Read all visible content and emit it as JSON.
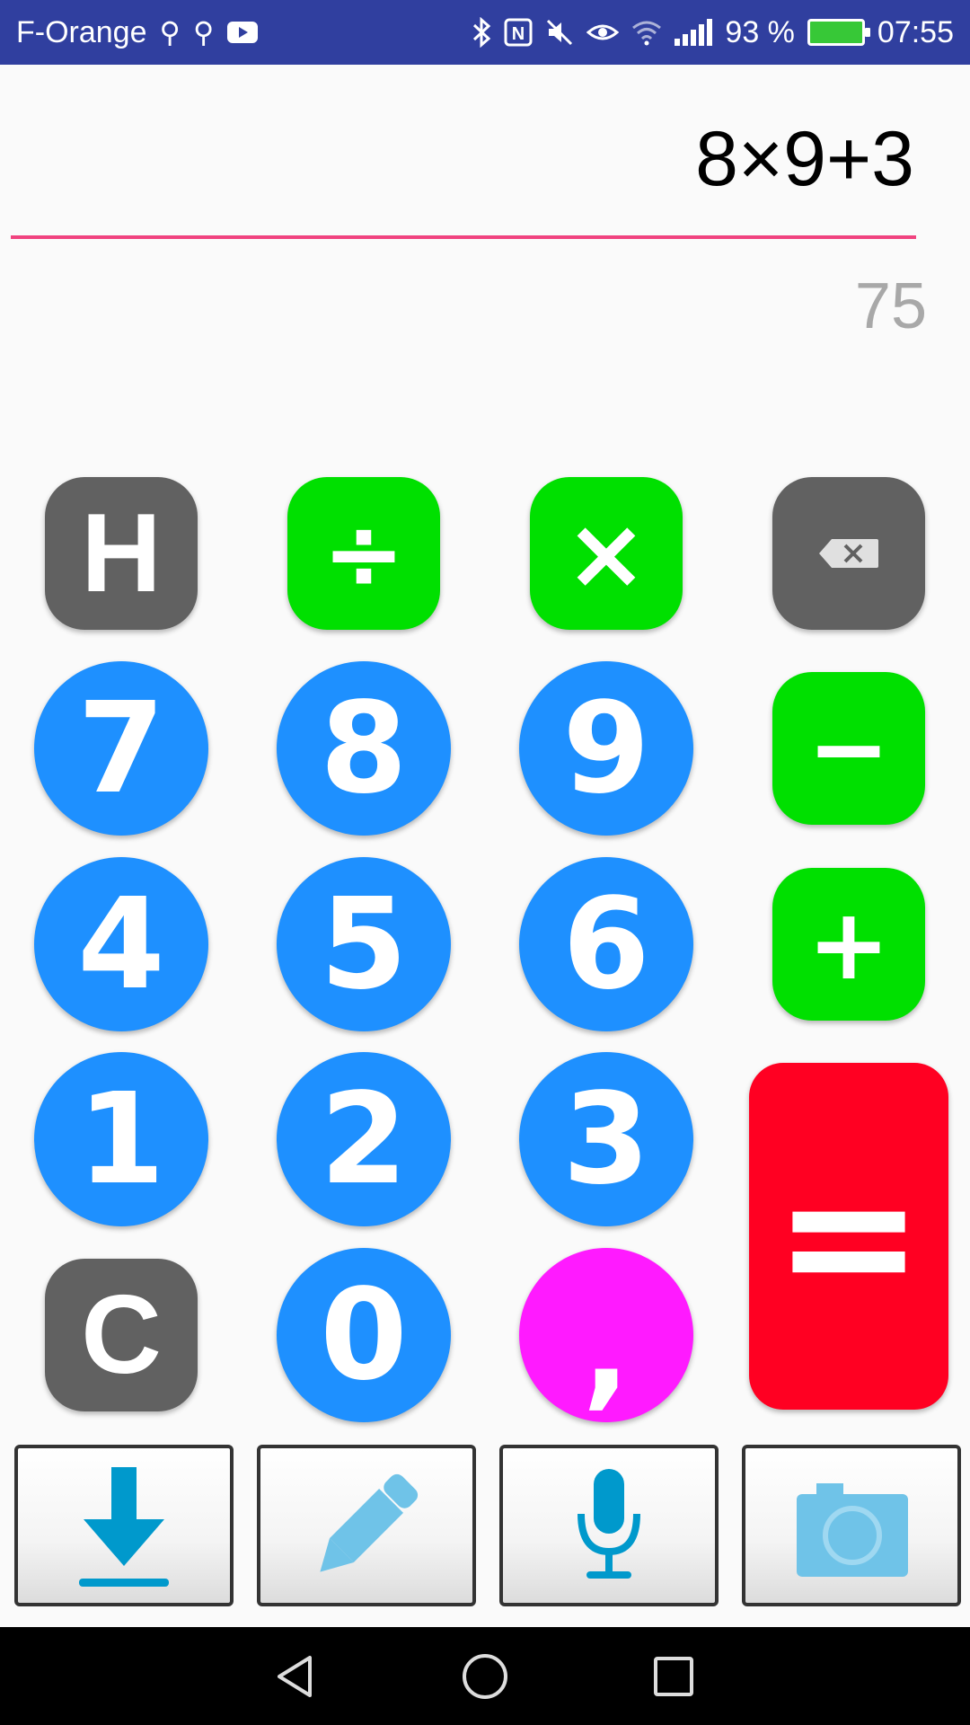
{
  "status_bar": {
    "carrier": "F-Orange",
    "battery_percent": "93 %",
    "time": "07:55",
    "battery_level": 0.93
  },
  "display": {
    "expression": "8×9+3",
    "result": "75"
  },
  "keypad": {
    "history": "H",
    "divide": "÷",
    "multiply": "×",
    "minus": "−",
    "plus": "+",
    "equals": "=",
    "clear": "C",
    "comma": ",",
    "digits": {
      "d0": "0",
      "d1": "1",
      "d2": "2",
      "d3": "3",
      "d4": "4",
      "d5": "5",
      "d6": "6",
      "d7": "7",
      "d8": "8",
      "d9": "9"
    }
  },
  "colors": {
    "digit": "#1e90ff",
    "operator": "#00e000",
    "function": "#616161",
    "comma": "#ff1aff",
    "equals": "#ff0022",
    "underline": "#f0437f",
    "status_bar": "#303f9f"
  },
  "icons": {
    "backspace": "backspace-icon",
    "download": "download-icon",
    "pencil": "pencil-icon",
    "microphone": "microphone-icon",
    "camera": "camera-icon"
  }
}
